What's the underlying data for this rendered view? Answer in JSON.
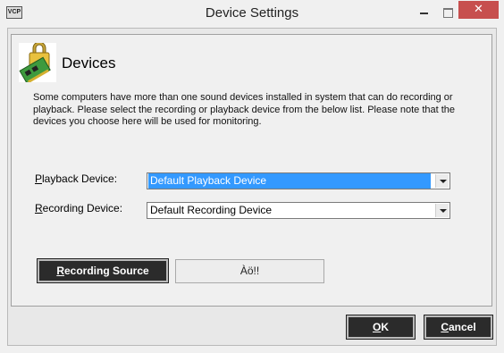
{
  "window": {
    "title": "Device Settings",
    "app_icon_text": "VCP",
    "close_glyph": "✕"
  },
  "header": {
    "title": "Devices",
    "description": "Some computers have more than one sound devices installed in system that can do recording or playback. Please select the recording or playback device from the below list. Please note that the devices you choose here will be used for monitoring."
  },
  "playback": {
    "label_access": "P",
    "label_rest": "layback Device:",
    "value": "Default Playback Device"
  },
  "recording": {
    "label_access": "R",
    "label_rest": "ecording Device:",
    "value": "Default Recording Device"
  },
  "recording_source": {
    "button_access": "R",
    "button_rest": "ecording Source",
    "current": "Àö!!"
  },
  "footer": {
    "ok_access": "O",
    "ok_rest": "K",
    "cancel_access": "C",
    "cancel_rest": "ancel"
  },
  "colors": {
    "close_button": "#c74f4e",
    "selection": "#3399ff",
    "button_bg": "#2b2b2b"
  }
}
